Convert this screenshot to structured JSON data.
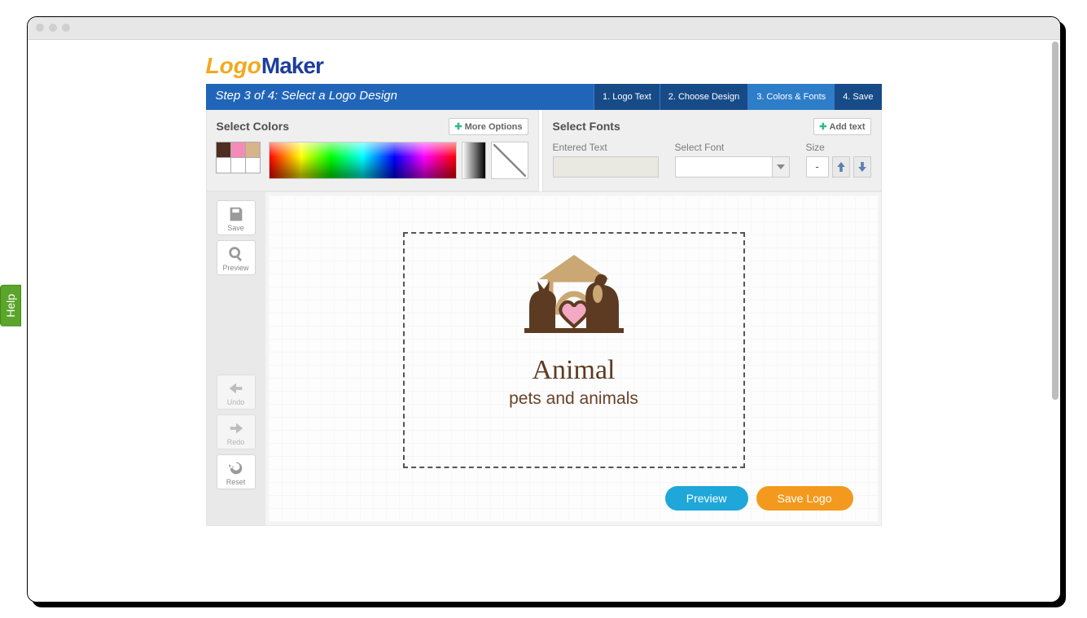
{
  "brand": {
    "part1": "Logo",
    "part2": "Maker"
  },
  "stepbar": {
    "title": "Step 3 of 4: Select a Logo Design",
    "steps": [
      {
        "label": "1. Logo Text"
      },
      {
        "label": "2. Choose Design"
      },
      {
        "label": "3. Colors & Fonts",
        "active": true
      },
      {
        "label": "4. Save"
      }
    ]
  },
  "colors_panel": {
    "title": "Select Colors",
    "more_button": "More Options",
    "swatches": [
      "#4d2d1f",
      "#f48bb8",
      "#d7b48a"
    ]
  },
  "fonts_panel": {
    "title": "Select Fonts",
    "add_button": "Add text",
    "labels": {
      "entered": "Entered Text",
      "font": "Select Font",
      "size": "Size"
    },
    "values": {
      "entered": "",
      "font": "",
      "size": "-"
    }
  },
  "tools": {
    "save": "Save",
    "preview": "Preview",
    "undo": "Undo",
    "redo": "Redo",
    "reset": "Reset"
  },
  "logo": {
    "line1": "Animal",
    "line2": "pets and animals"
  },
  "actions": {
    "preview": "Preview",
    "save": "Save Logo"
  },
  "help": "Help"
}
